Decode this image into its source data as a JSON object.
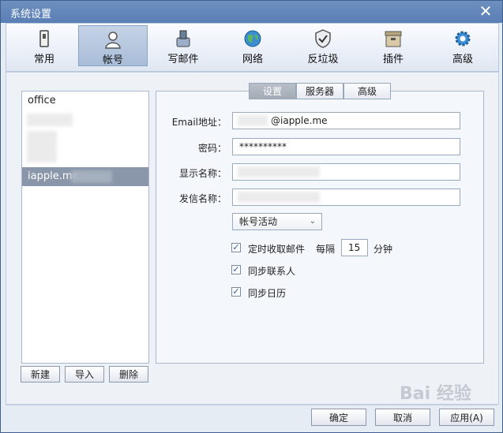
{
  "window": {
    "title": "系统设置",
    "close_glyph": "✕"
  },
  "toolbar": [
    {
      "label": "常用",
      "icon": "general-icon"
    },
    {
      "label": "帐号",
      "icon": "account-icon"
    },
    {
      "label": "写邮件",
      "icon": "compose-icon"
    },
    {
      "label": "网络",
      "icon": "network-icon"
    },
    {
      "label": "反垃圾",
      "icon": "antispam-icon"
    },
    {
      "label": "插件",
      "icon": "plugin-icon"
    },
    {
      "label": "高级",
      "icon": "advanced-icon"
    }
  ],
  "accounts": {
    "items": [
      {
        "label": "office"
      },
      {
        "label": ""
      },
      {
        "label": ""
      },
      {
        "label": "iapple.me"
      }
    ],
    "buttons": {
      "new": "新建",
      "import": "导入",
      "delete": "删除"
    }
  },
  "tabs": [
    "设置",
    "服务器",
    "高级"
  ],
  "form": {
    "email_label": "Email地址：",
    "email_value": "@iapple.me",
    "password_label": "密码：",
    "password_value": "**********",
    "display_label": "显示名称：",
    "display_value": "",
    "sender_label": "发信名称：",
    "sender_value": "",
    "status_select": "帐号活动",
    "auto_fetch_label": "定时收取邮件",
    "every_label": "每隔",
    "interval_value": "15",
    "minutes_label": "分钟",
    "sync_contacts_label": "同步联系人",
    "sync_calendar_label": "同步日历"
  },
  "footer": {
    "ok": "确定",
    "cancel": "取消",
    "apply": "应用(A)"
  },
  "watermark": "Bai 经验"
}
